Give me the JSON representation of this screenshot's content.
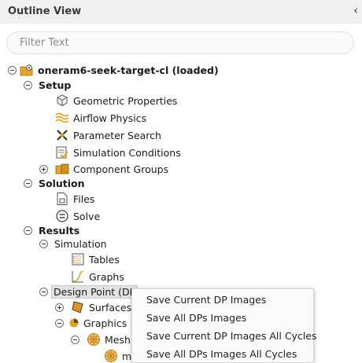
{
  "panel": {
    "title": "Outline View"
  },
  "search": {
    "placeholder": "Filter Text"
  },
  "tree": {
    "case_label": "oneram6-seek-target-cl  (loaded)",
    "setup": "Setup",
    "geometric": "Geometric Properties",
    "airflow": "Airflow Physics",
    "parameter": "Parameter Search",
    "simulation_conditions": "Simulation Conditions",
    "component_groups": "Component Groups",
    "solution": "Solution",
    "files": "Files",
    "solve": "Solve",
    "results": "Results",
    "simulation": "Simulation",
    "tables": "Tables",
    "graphs": "Graphs",
    "design_point": "Design Point (DP",
    "surfaces": "Surfaces",
    "graphics": "Graphics",
    "mesh": "Mesh",
    "mesh_child": "m"
  },
  "context_menu": {
    "items": [
      "Save Current DP Images",
      "Save All DPs Images",
      "Save Current DP Images All Cycles",
      "Save All DPs Images All Cycles"
    ]
  },
  "colors": {
    "accent": "#e0a020",
    "selection": "#e3e3e3"
  }
}
